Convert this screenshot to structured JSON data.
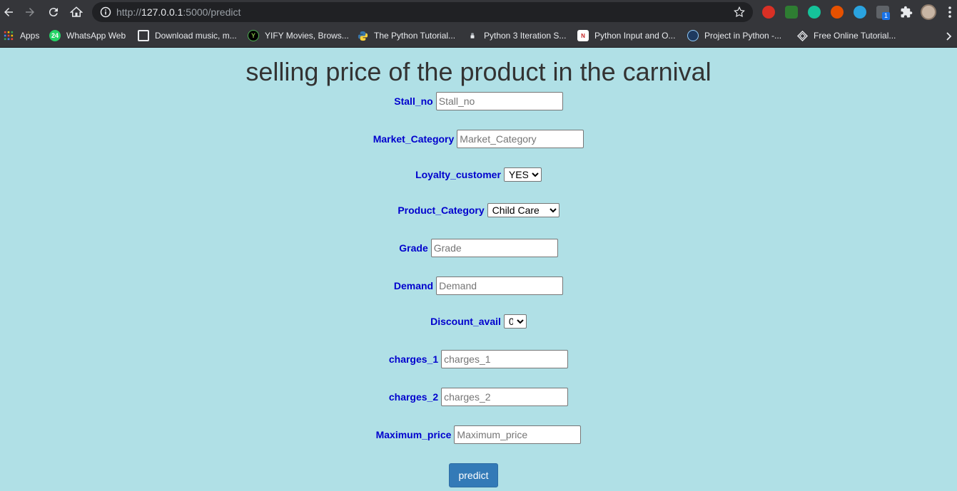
{
  "browser": {
    "url_prefix": "http://",
    "url_host": "127.0.0.1",
    "url_rest": ":5000/predict",
    "bookmarks": [
      {
        "label": "Apps",
        "icon": "apps-grid-icon"
      },
      {
        "label": "WhatsApp Web",
        "icon": "whatsapp-icon",
        "badge": "24"
      },
      {
        "label": "Download music, m...",
        "icon": "download-site-icon"
      },
      {
        "label": "YIFY Movies, Brows...",
        "icon": "yify-icon"
      },
      {
        "label": "The Python Tutorial...",
        "icon": "python-icon"
      },
      {
        "label": "Python 3 Iteration S...",
        "icon": "bookmark-site-icon"
      },
      {
        "label": "Python Input and O...",
        "icon": "bookmark-site-icon"
      },
      {
        "label": "Project in Python -...",
        "icon": "globe-icon"
      },
      {
        "label": "Free Online Tutorial...",
        "icon": "tutorial-site-icon"
      }
    ],
    "extensions_badge": "1"
  },
  "page": {
    "title": "selling price of the product in the carnival",
    "fields": {
      "stall_no": {
        "label": "Stall_no",
        "placeholder": "Stall_no"
      },
      "market_category": {
        "label": "Market_Category",
        "placeholder": "Market_Category"
      },
      "loyalty_customer": {
        "label": "Loyalty_customer",
        "selected": "YES"
      },
      "product_category": {
        "label": "Product_Category",
        "selected": "Child Care"
      },
      "grade": {
        "label": "Grade",
        "placeholder": "Grade"
      },
      "demand": {
        "label": "Demand",
        "placeholder": "Demand"
      },
      "discount_avail": {
        "label": "Discount_avail",
        "selected": "0"
      },
      "charges_1": {
        "label": "charges_1",
        "placeholder": "charges_1"
      },
      "charges_2": {
        "label": "charges_2",
        "placeholder": "charges_2"
      },
      "maximum_price": {
        "label": "Maximum_price",
        "placeholder": "Maximum_price"
      }
    },
    "submit_label": "predict"
  },
  "colors": {
    "page_background": "#b0e0e6",
    "label_color": "#0000cd",
    "button_color": "#337ab7"
  }
}
